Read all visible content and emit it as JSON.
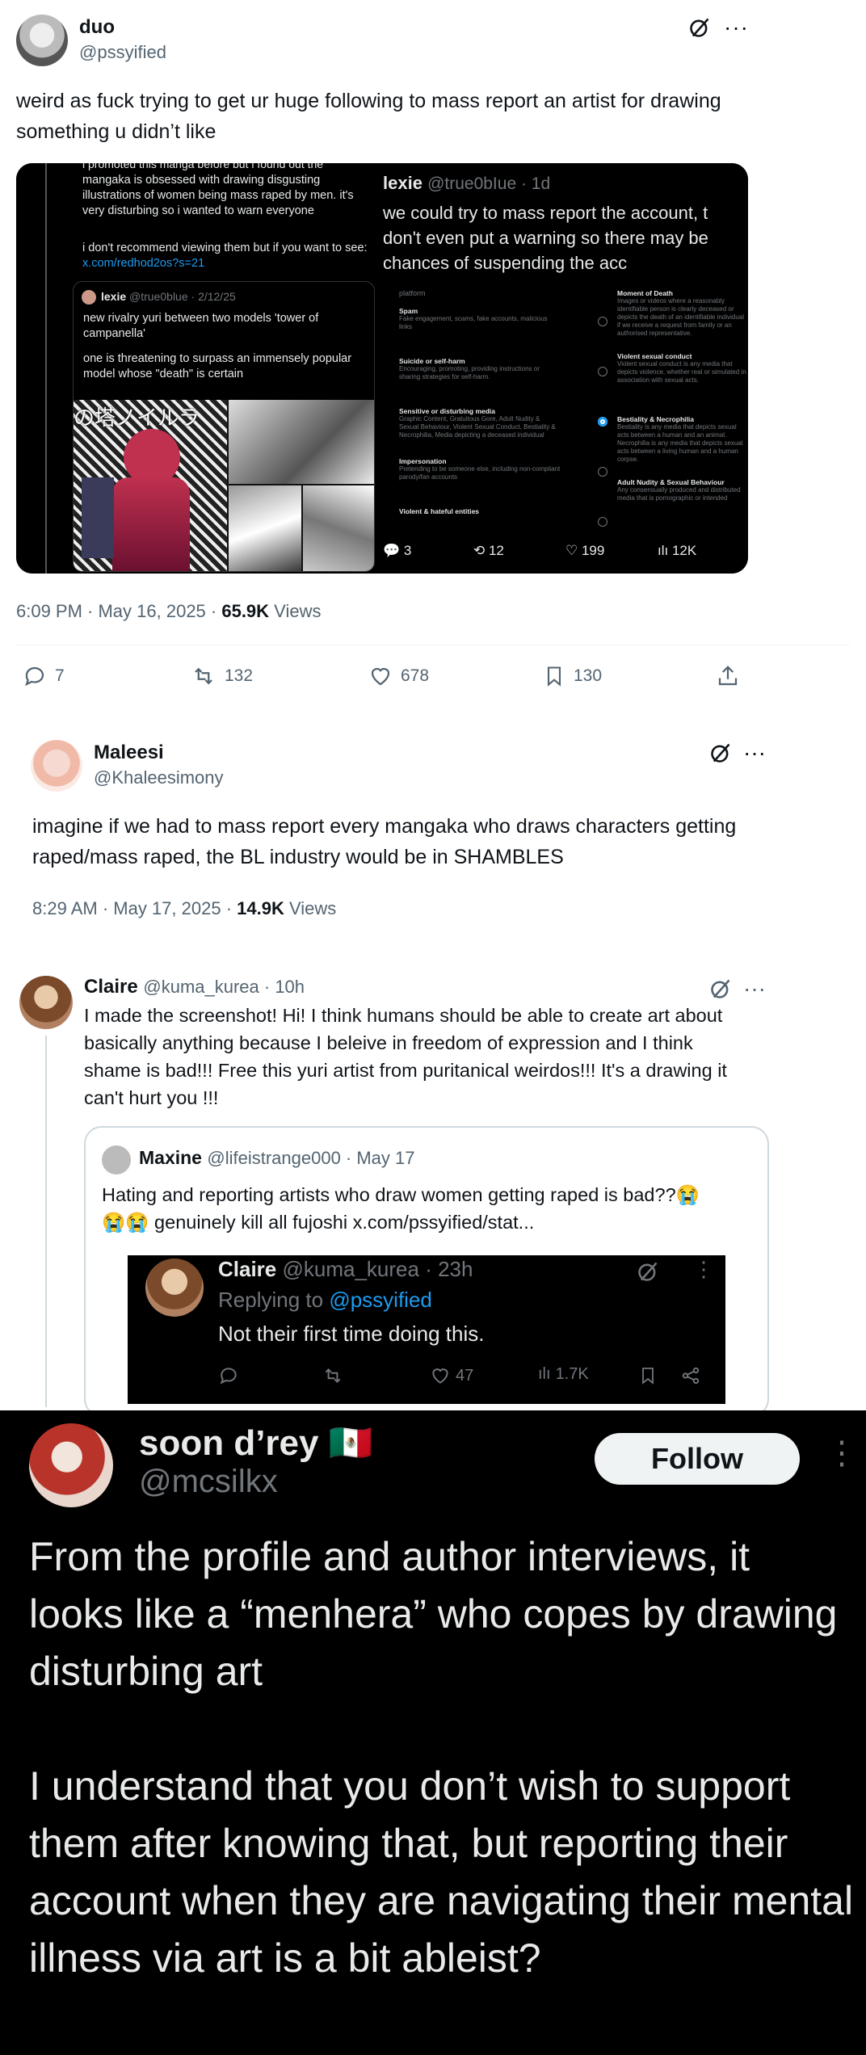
{
  "tweet1": {
    "name": "duo",
    "handle": "@pssyified",
    "text": "weird as fuck trying to get ur huge following to mass report an artist for drawing something u didn’t like",
    "time": "6:09 PM · May 16, 2025 · ",
    "views_count": "65.9K",
    "views_label": " Views",
    "replies": "7",
    "reposts": "132",
    "likes": "678",
    "bookmarks": "130",
    "left_image": {
      "top_cut": "i promoted this manga before but i found out the",
      "text1": "mangaka is obsessed with drawing disgusting illustrations of women being mass raped by men. it's very disturbing so i wanted to warn everyone",
      "text2": "i don't recommend viewing them but if you want to see: ",
      "link": "x.com/redhod2os?s=21",
      "quote_name": "lexie",
      "quote_handle": "@true0blue · 2/12/25",
      "quote_text1": "new rivalry yuri between two models 'tower of campanella'",
      "quote_text2": "one is threatening to surpass an immensely popular model whose \"death\" is certain",
      "manga_title": "の塔ノイルラ"
    },
    "right_image": {
      "name": "lexie",
      "handle": "@true0bIue · 1d",
      "text": "we could try to mass report the account, t don't even put a warning so there may be chances of suspending the acc",
      "section": "platform",
      "options": [
        {
          "title": "Spam",
          "desc": "Fake engagement, scams, fake accounts, malicious links",
          "selected": false
        },
        {
          "title": "Suicide or self-harm",
          "desc": "Encouraging, promoting, providing instructions or sharing strategies for self-harm.",
          "selected": false
        },
        {
          "title": "Sensitive or disturbing media",
          "desc": "Graphic Content, Gratuitous Gore, Adult Nudity & Sexual Behaviour, Violent Sexual Conduct, Bestiality & Necrophilia, Media depicting a deceased individual",
          "selected": true
        },
        {
          "title": "Impersonation",
          "desc": "Pretending to be someone else, including non-compliant parody/fan accounts",
          "selected": false
        },
        {
          "title": "Violent & hateful entities",
          "desc": "",
          "selected": false
        }
      ],
      "right_col": [
        {
          "title": "Moment of Death",
          "desc": "Images or videos where a reasonably identifiable person is clearly deceased or depicts the death of an identifiable individual if we receive a request from family or an authorised representative."
        },
        {
          "title": "Violent sexual conduct",
          "desc": "Violent sexual conduct is any media that depicts violence, whether real or simulated in association with sexual acts."
        },
        {
          "title": "Bestiality & Necrophilia",
          "desc": "Bestiality is any media that depicts sexual acts between a human and an animal. Necrophilia is any media that depicts sexual acts between a living human and a human corpse."
        },
        {
          "title": "Adult Nudity & Sexual Behaviour",
          "desc": "Any consensually produced and distributed media that is pornographic or intended"
        }
      ],
      "replies": "3",
      "reposts": "12",
      "likes": "199",
      "views": "12K"
    }
  },
  "tweet2": {
    "name": "Maleesi",
    "handle": "@Khaleesimony",
    "text": "imagine if we had to mass report every mangaka who draws characters getting raped/mass raped, the BL industry would be in SHAMBLES",
    "time": "8:29 AM · May 17, 2025 · ",
    "views_count": "14.9K",
    "views_label": " Views"
  },
  "tweet3": {
    "name": "Claire",
    "handle": "@kuma_kurea · 10h",
    "text": "I made the screenshot! Hi! I think humans should be able to create art about basically anything because I beleive in freedom of expression and I think shame is bad!!! Free this yuri artist from puritanical weirdos!!! It's a drawing it can't hurt you !!!",
    "quote": {
      "name": "Maxine",
      "handle": "@lifeistrange000 · May 17",
      "text1": "Hating and reporting artists who draw women getting raped is bad??😭",
      "text2": "😭😭 genuinely kill all fujoshi  x.com/pssyified/stat..."
    },
    "inner": {
      "name": "Claire",
      "handle": "@kuma_kurea · 23h",
      "reply_prefix": "Replying to ",
      "reply_handle": "@pssyified",
      "text": "Not their first time doing this.",
      "likes": "47",
      "views": "1.7K"
    }
  },
  "tweet4": {
    "name": "soon d’rey 🇲🇽",
    "handle": "@mcsilkx",
    "follow": "Follow",
    "text1": "From the profile and author interviews, it looks like a “menhera” who copes by drawing disturbing art",
    "text2": "I understand that you don’t wish to support them after knowing that, but reporting their account when they are navigating their mental illness via art is a bit ableist?"
  },
  "colors": {
    "accent": "#1d9bf0",
    "muted": "#536471",
    "dark_bg": "#000000",
    "selected_radio": "#1d9bf0"
  }
}
